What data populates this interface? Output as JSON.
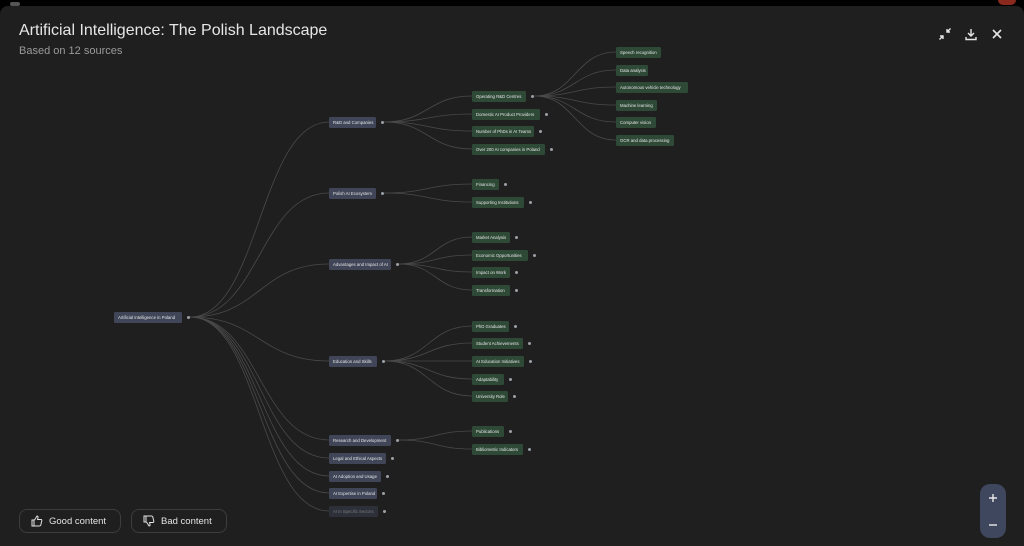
{
  "header": {
    "title": "Artificial Intelligence: The Polish Landscape",
    "subtitle": "Based on 12 sources"
  },
  "mindmap": {
    "root": "Artificial Intelligence in Poland",
    "branches": [
      {
        "id": "b1",
        "label": "R&D and Companies",
        "children": [
          {
            "id": "c1",
            "label": "Operating R&D Centres",
            "children": [
              "Speech recognition",
              "Data analysis",
              "Autonomous vehicle technology",
              "Machine learning",
              "Computer vision",
              "OCR and data processing"
            ]
          },
          {
            "id": "c2",
            "label": "Domestic AI Product Providers"
          },
          {
            "id": "c3",
            "label": "Number of PhDs in AI Teams"
          },
          {
            "id": "c4",
            "label": "Over 200 AI companies in Poland"
          }
        ]
      },
      {
        "id": "b2",
        "label": "Polish AI Ecosystem",
        "children": [
          {
            "id": "c5",
            "label": "Financing"
          },
          {
            "id": "c6",
            "label": "Supporting Institutions"
          }
        ]
      },
      {
        "id": "b3",
        "label": "Advantages and Impact of AI",
        "children": [
          {
            "id": "c7",
            "label": "Market Analysis"
          },
          {
            "id": "c8",
            "label": "Economic Opportunities"
          },
          {
            "id": "c9",
            "label": "Impact on Work"
          },
          {
            "id": "c10",
            "label": "Transformation"
          }
        ]
      },
      {
        "id": "b4",
        "label": "Education and Skills",
        "children": [
          {
            "id": "c11",
            "label": "PhD Graduates"
          },
          {
            "id": "c12",
            "label": "Student Achievements"
          },
          {
            "id": "c13",
            "label": "AI Education Initiatives"
          },
          {
            "id": "c14",
            "label": "Adaptability"
          },
          {
            "id": "c15",
            "label": "University Role"
          }
        ]
      },
      {
        "id": "b5",
        "label": "Research and Development",
        "children": [
          {
            "id": "c16",
            "label": "Publications"
          },
          {
            "id": "c17",
            "label": "Bibliometric Indicators"
          }
        ]
      },
      {
        "id": "b6",
        "label": "Legal and Ethical Aspects"
      },
      {
        "id": "b7",
        "label": "AI Adoption and Usage"
      },
      {
        "id": "b8",
        "label": "AI Expertise in Poland"
      },
      {
        "id": "b9",
        "label": "AI in Specific Sectors"
      }
    ]
  },
  "footer": {
    "good_label": "Good content",
    "bad_label": "Bad content"
  },
  "icons": {
    "collapse": "collapse-icon",
    "download": "download-icon",
    "close": "close-icon",
    "thumbs_up": "thumbs-up-icon",
    "thumbs_down": "thumbs-down-icon",
    "zoom_in": "zoom-in-icon",
    "zoom_out": "zoom-out-icon"
  },
  "colors": {
    "background": "#1f1f1f",
    "branch_node": "#404658",
    "leaf_node": "#2e4a37",
    "connector": "#4a4a4a",
    "zoom_control": "#3f475e"
  }
}
